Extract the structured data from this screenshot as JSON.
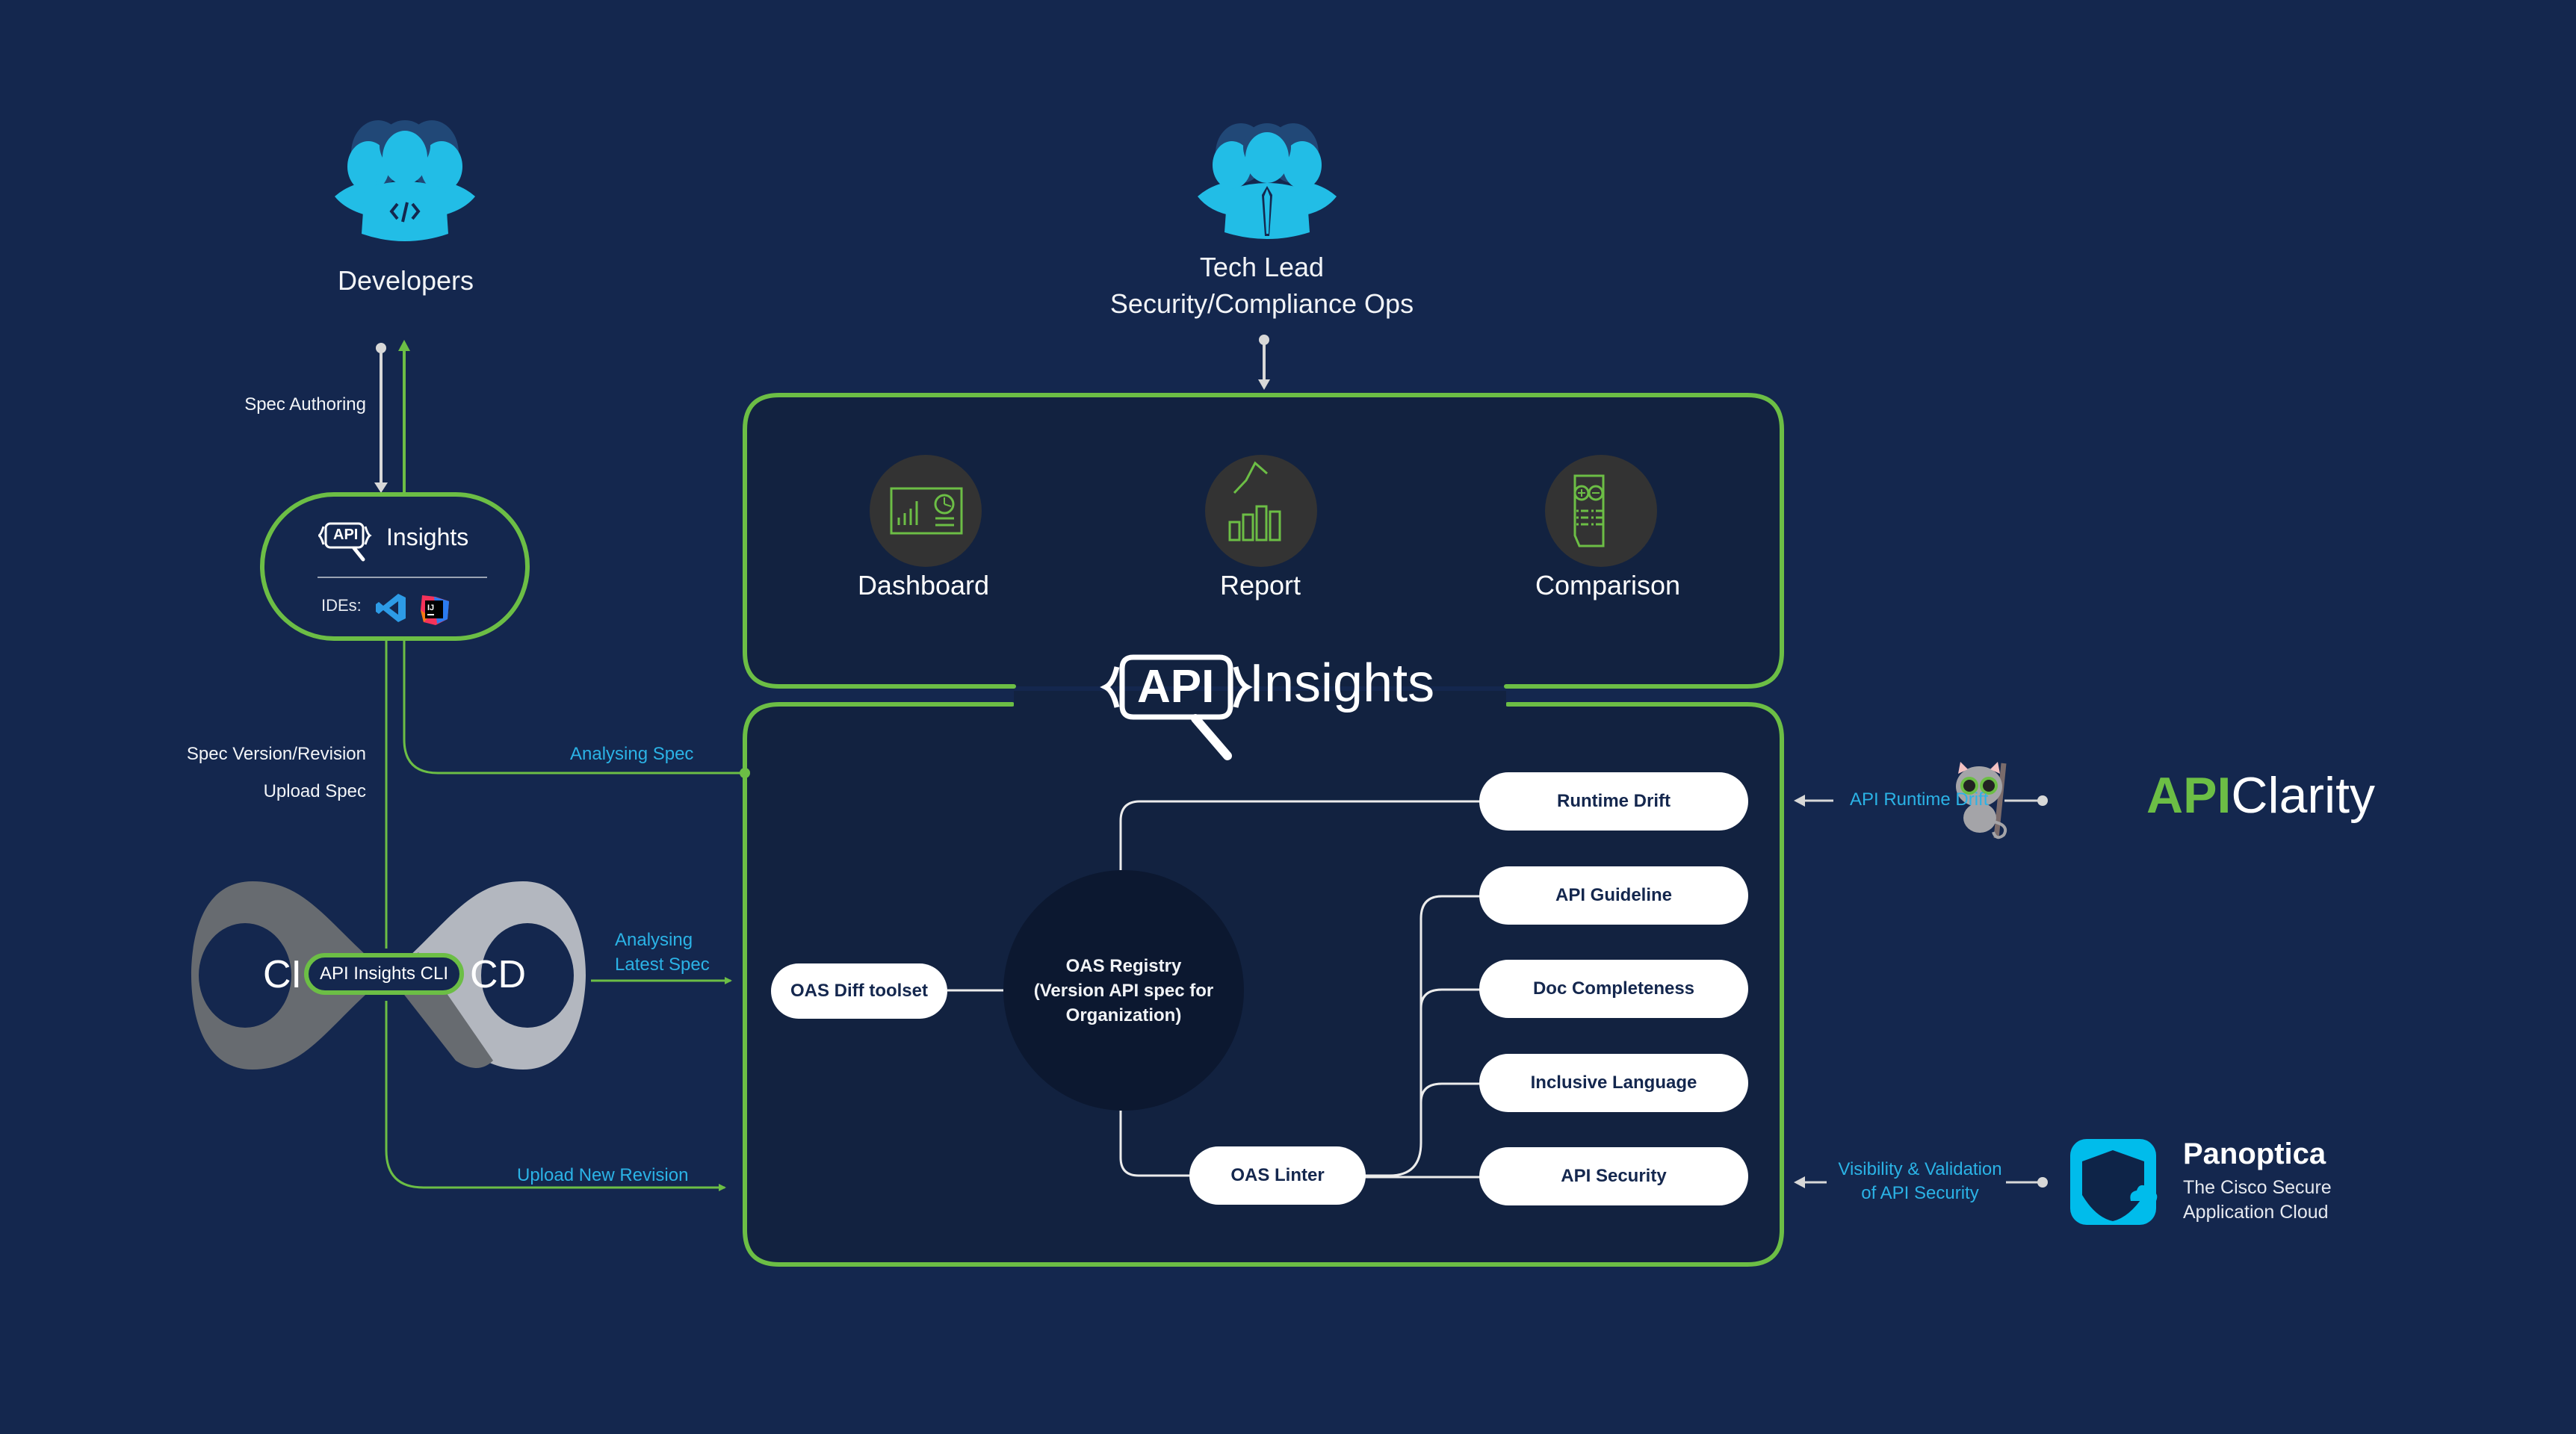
{
  "colors": {
    "background": "#14274E",
    "panel": "#122240",
    "accent_green": "#6CBE45",
    "accent_blue": "#2BB3E6",
    "person_icon": "#22BDE6",
    "connector_gray": "#D8D8D8",
    "registry_fill": "#0C1830"
  },
  "personas": {
    "developers": {
      "label": "Developers",
      "icon": "developers-group-icon"
    },
    "tech_lead": {
      "line1": "Tech Lead",
      "line2": "Security/Compliance Ops",
      "icon": "business-group-icon"
    }
  },
  "ide_plugin": {
    "logo_api": "API",
    "logo_text": "Insights",
    "ides_label": "IDEs:",
    "ides": [
      "Visual Studio Code",
      "IntelliJ IDEA"
    ]
  },
  "flows": {
    "spec_authoring": "Spec Authoring",
    "spec_version_revision": "Spec Version/Revision",
    "upload_spec": "Upload Spec",
    "analysing_spec": "Analysing Spec",
    "analysing_latest_spec_1": "Analysing",
    "analysing_latest_spec_2": "Latest Spec",
    "upload_new_revision": "Upload New Revision",
    "api_runtime_drift": "API Runtime Drift",
    "visibility_1": "Visibility & Validation",
    "visibility_2": "of API Security"
  },
  "cicd": {
    "ci": "CI",
    "cd": "CD",
    "cli": "API Insights CLI"
  },
  "features": [
    {
      "label": "Dashboard",
      "icon": "dashboard-icon"
    },
    {
      "label": "Report",
      "icon": "report-chart-icon"
    },
    {
      "label": "Comparison",
      "icon": "comparison-document-icon"
    }
  ],
  "brand": {
    "api": "API",
    "insights": "Insights"
  },
  "core": {
    "diff_toolset": "OAS Diff toolset",
    "registry_line1": "OAS Registry",
    "registry_line2": "(Version API spec for",
    "registry_line3": "Organization)",
    "linter": "OAS Linter",
    "checks": [
      "Runtime Drift",
      "API Guideline",
      "Doc Completeness",
      "Inclusive Language",
      "API Security"
    ]
  },
  "integrations": {
    "apiclarity": {
      "api": "API",
      "clarity": "Clarity"
    },
    "panoptica": {
      "title": "Panoptica",
      "sub1": "The Cisco Secure",
      "sub2": "Application Cloud"
    }
  }
}
